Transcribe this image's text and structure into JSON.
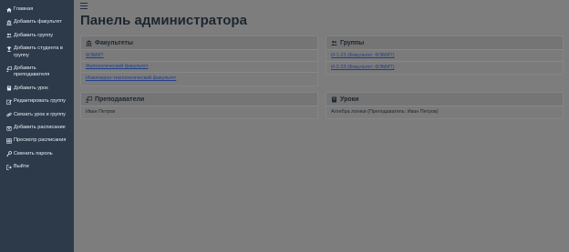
{
  "sidebar": {
    "items": [
      {
        "label": "Главная",
        "icon": "home-icon"
      },
      {
        "label": "Добавить факультет",
        "icon": "university-icon"
      },
      {
        "label": "Добавить группу",
        "icon": "users-icon"
      },
      {
        "label": "Добавить студента в группу",
        "icon": "user-graduate-icon"
      },
      {
        "label": "Добавить преподавателя",
        "icon": "chalkboard-teacher-icon"
      },
      {
        "label": "Добавить урок",
        "icon": "book-icon"
      },
      {
        "label": "Редактировать группу",
        "icon": "edit-icon"
      },
      {
        "label": "Связать урок и группу",
        "icon": "link-icon"
      },
      {
        "label": "Добавить расписание",
        "icon": "calendar-plus-icon"
      },
      {
        "label": "Просмотр расписания",
        "icon": "table-icon"
      },
      {
        "label": "Сменить пароль",
        "icon": "key-icon"
      },
      {
        "label": "Выйти",
        "icon": "sign-out-icon"
      }
    ]
  },
  "header": {
    "title": "Панель администратора"
  },
  "cards": {
    "faculties": {
      "title": "Факультеты",
      "items": [
        "ФЭМИТ",
        "Филологический факультет",
        "Инженерно-технологический факультет"
      ]
    },
    "groups": {
      "title": "Группы",
      "items": [
        "И-1-23 (Факультет: ФЭМИТ)",
        "И-2-23 (Факультет: ФЭМИТ)"
      ]
    },
    "teachers": {
      "title": "Преподаватели",
      "items": [
        "Иван Петров"
      ]
    },
    "lessons": {
      "title": "Уроки",
      "items": [
        "Алгебра логики (Преподаватель: Иван Петров)"
      ]
    }
  },
  "colors": {
    "sidebar_bg": "#2c3a4a",
    "overlay_bg": "#7d7d7d",
    "link": "#1f3f8a",
    "text": "#1d2630"
  }
}
